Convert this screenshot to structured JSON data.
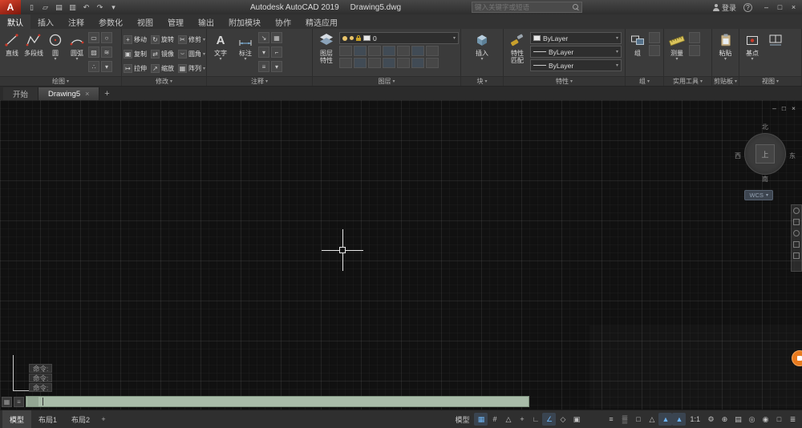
{
  "titlebar": {
    "logo_letter": "A",
    "app_name": "Autodesk AutoCAD 2019",
    "doc_name": "Drawing5.dwg",
    "search_placeholder": "键入关键字或短语",
    "signin_label": "登录",
    "help_glyph": "?",
    "qat_icons": [
      {
        "name": "new-file-icon",
        "glyph": "▯"
      },
      {
        "name": "open-file-icon",
        "glyph": "▱"
      },
      {
        "name": "save-icon",
        "glyph": "▤"
      },
      {
        "name": "plot-icon",
        "glyph": "▥"
      },
      {
        "name": "undo-icon",
        "glyph": "↶"
      },
      {
        "name": "redo-icon",
        "glyph": "↷"
      },
      {
        "name": "qat-customize-icon",
        "glyph": "▾"
      }
    ],
    "window_controls": {
      "minimize": "–",
      "maximize": "□",
      "close": "×"
    }
  },
  "menu_tabs": [
    {
      "label": "默认",
      "active": true
    },
    {
      "label": "插入",
      "active": false
    },
    {
      "label": "注释",
      "active": false
    },
    {
      "label": "参数化",
      "active": false
    },
    {
      "label": "视图",
      "active": false
    },
    {
      "label": "管理",
      "active": false
    },
    {
      "label": "输出",
      "active": false
    },
    {
      "label": "附加模块",
      "active": false
    },
    {
      "label": "协作",
      "active": false
    },
    {
      "label": "精选应用",
      "active": false
    }
  ],
  "ribbon": {
    "draw": {
      "footer": "绘图",
      "line_label": "直线",
      "polyline_label": "多段线",
      "circle_label": "圆",
      "arc_label": "圆弧",
      "mini_icons": [
        {
          "name": "rectangle-icon",
          "glyph": "▭"
        },
        {
          "name": "ellipse-icon",
          "glyph": "○"
        },
        {
          "name": "hatch-icon",
          "glyph": "▨"
        },
        {
          "name": "revision-cloud-icon",
          "glyph": "≋"
        },
        {
          "name": "point-icon",
          "glyph": "∴"
        },
        {
          "name": "draw-more-icon",
          "glyph": "▾"
        }
      ]
    },
    "modify": {
      "footer": "修改",
      "buttons": [
        {
          "label": "移动",
          "glyph": "+"
        },
        {
          "label": "旋转",
          "glyph": "↻"
        },
        {
          "label": "修剪",
          "glyph": "✂"
        },
        {
          "label": "复制",
          "glyph": "▣"
        },
        {
          "label": "镜像",
          "glyph": "⇄"
        },
        {
          "label": "圆角",
          "glyph": "⌣"
        },
        {
          "label": "拉伸",
          "glyph": "↦"
        },
        {
          "label": "缩放",
          "glyph": "↗"
        },
        {
          "label": "阵列",
          "glyph": "▦"
        }
      ]
    },
    "annotate": {
      "footer": "注释",
      "text_icon_glyph": "A",
      "text_label": "文字",
      "dim_label": "标注",
      "mini_icons": [
        {
          "name": "leader-icon",
          "glyph": "↘"
        },
        {
          "name": "table-icon",
          "glyph": "▦"
        },
        {
          "name": "text-style-icon",
          "glyph": "▾"
        },
        {
          "name": "dim-style-icon",
          "glyph": "⌐"
        },
        {
          "name": "centerline-icon",
          "glyph": "≡"
        },
        {
          "name": "annotate-more-icon",
          "glyph": "▾"
        }
      ]
    },
    "layers": {
      "footer": "图层",
      "big_label_line1": "图层",
      "big_label_line2": "特性",
      "current_layer": "0"
    },
    "block": {
      "footer": "块",
      "insert_label": "插入"
    },
    "properties": {
      "footer": "特性",
      "big_label_line1": "特性",
      "big_label_line2": "匹配",
      "color_value": "ByLayer",
      "linetype_value": "ByLayer",
      "lineweight_value": "ByLayer"
    },
    "group": {
      "footer": "组",
      "group_label": "组"
    },
    "utilities": {
      "footer": "实用工具",
      "measure_label": "测量"
    },
    "clipboard": {
      "footer": "剪贴板",
      "paste_label": "粘贴"
    },
    "view": {
      "footer": "视图",
      "base_label": "基点"
    }
  },
  "file_tabs": {
    "start": "开始",
    "drawing": "Drawing5",
    "close_glyph": "×",
    "new_glyph": "+"
  },
  "canvas": {
    "doc_controls": {
      "minimize": "–",
      "restore": "□",
      "close": "×"
    },
    "viewcube": {
      "north": "北",
      "south": "南",
      "west": "西",
      "east": "东",
      "top": "上",
      "wcs": "WCS"
    },
    "command_history": [
      "命令:",
      "命令:",
      "命令:"
    ],
    "command_icons": [
      {
        "name": "command-grip-icon",
        "glyph": "▦"
      },
      {
        "name": "command-customize-icon",
        "glyph": "≡"
      }
    ]
  },
  "statusbar": {
    "tabs": [
      {
        "label": "模型",
        "active": true
      },
      {
        "label": "布局1",
        "active": false
      },
      {
        "label": "布局2",
        "active": false
      }
    ],
    "new_layout_glyph": "+",
    "model_button": "模型",
    "scale_value": "1:1",
    "left_icons": [
      {
        "name": "grid-icon",
        "glyph": "▦",
        "active": true
      },
      {
        "name": "snap-icon",
        "glyph": "#",
        "active": false
      },
      {
        "name": "infer-constraints-icon",
        "glyph": "△",
        "active": false
      },
      {
        "name": "dynamic-input-icon",
        "glyph": "+",
        "active": false
      },
      {
        "name": "ortho-icon",
        "glyph": "∟",
        "active": false
      },
      {
        "name": "polar-tracking-icon",
        "glyph": "∠",
        "active": true
      },
      {
        "name": "isodraft-icon",
        "glyph": "◇",
        "active": false
      },
      {
        "name": "osnap-icon",
        "glyph": "▣",
        "active": false
      }
    ],
    "right_icons": [
      {
        "name": "lineweight-icon",
        "glyph": "≡",
        "active": false
      },
      {
        "name": "transparency-icon",
        "glyph": "▒",
        "active": false
      },
      {
        "name": "selection-cycling-icon",
        "glyph": "□",
        "active": false
      },
      {
        "name": "dynamic-ucs-icon",
        "glyph": "△",
        "active": false
      },
      {
        "name": "annotation-visibility-icon",
        "glyph": "▲",
        "active": true
      },
      {
        "name": "autoscale-icon",
        "glyph": "▲",
        "active": true
      }
    ],
    "far_right_icons": [
      {
        "name": "workspace-gear-icon",
        "glyph": "⚙",
        "active": false
      },
      {
        "name": "annotation-monitor-icon",
        "glyph": "⊕",
        "active": false
      },
      {
        "name": "quick-properties-icon",
        "glyph": "▤",
        "active": false
      },
      {
        "name": "lock-ui-icon",
        "glyph": "◎",
        "active": false
      },
      {
        "name": "isolate-objects-icon",
        "glyph": "◉",
        "active": false
      },
      {
        "name": "clean-screen-icon",
        "glyph": "□",
        "active": false
      },
      {
        "name": "customize-icon",
        "glyph": "≣",
        "active": false
      }
    ]
  }
}
